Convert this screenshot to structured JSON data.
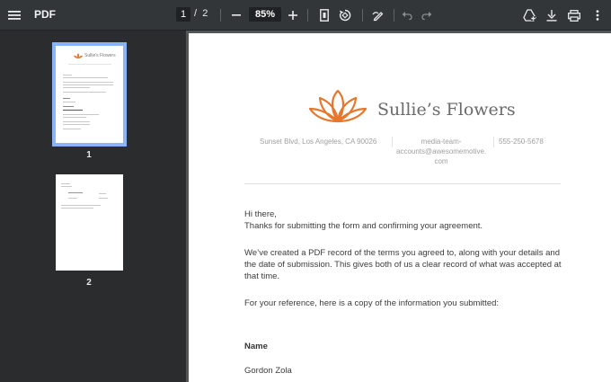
{
  "toolbar": {
    "title": "PDF",
    "current_page": "1",
    "page_separator": "/",
    "total_pages": "2",
    "zoom": "85%"
  },
  "sidebar": {
    "thumbnails": [
      {
        "label": "1",
        "selected": true
      },
      {
        "label": "2",
        "selected": false
      }
    ]
  },
  "document": {
    "brand": "Sullie’s Flowers",
    "address": "Sunset Blvd, Los Angeles, CA 90026",
    "email_line1": "media-team-",
    "email_line2": "accounts@awesomemotive.",
    "email_line3": "com",
    "phone": "555-250-5678",
    "greeting": "Hi there,",
    "thanks": "Thanks for submitting the form and confirming your agreement.",
    "paragraph1": "We’ve created a PDF record of the terms you agreed to, along with your details and the date of submission. This gives both of us a clear record of what was accepted at that time.",
    "paragraph2": "For your reference, here is a copy of the information you submitted:",
    "field_label": "Name",
    "field_value": "Gordon Zola",
    "logo_color": "#e8772e"
  }
}
